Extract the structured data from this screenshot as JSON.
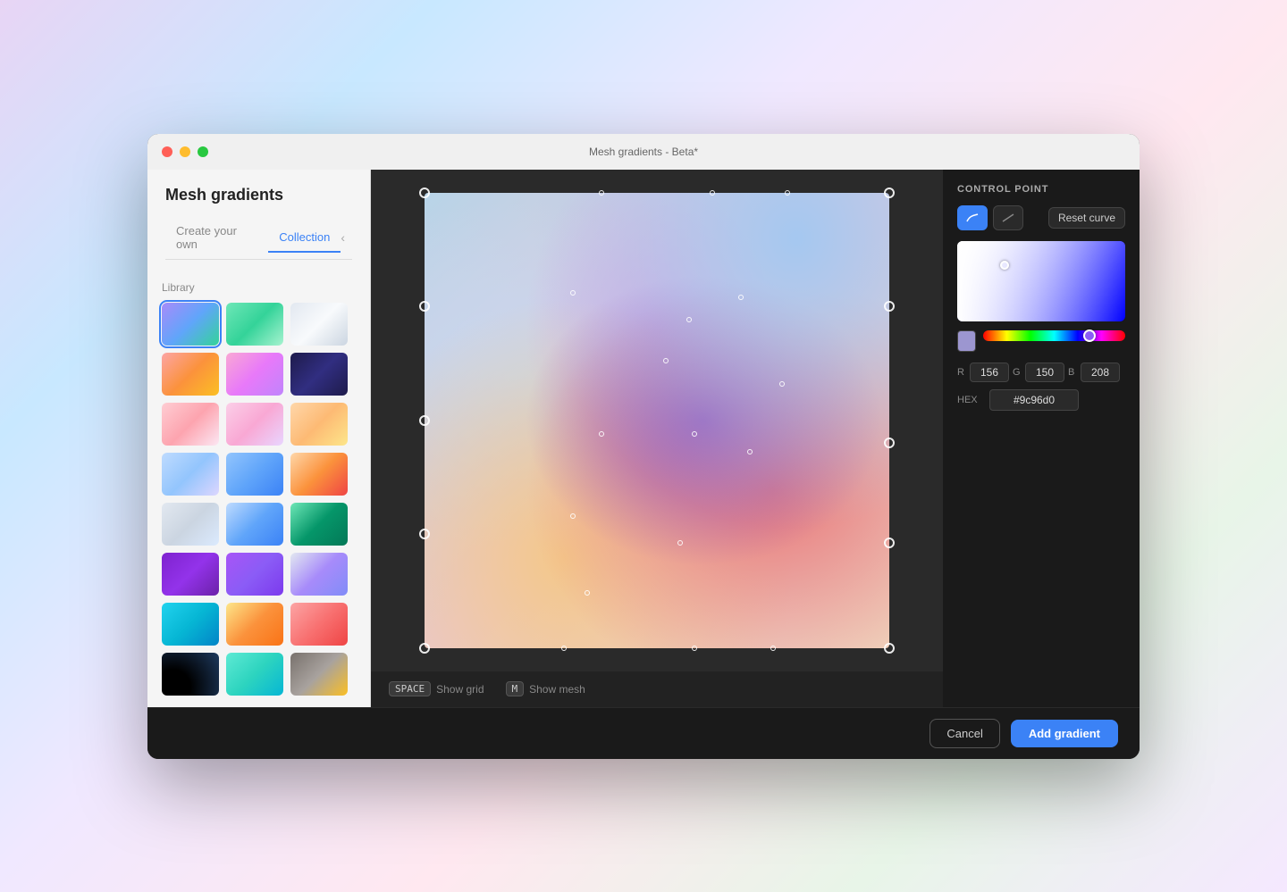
{
  "window": {
    "title": "Mesh gradients - Beta*"
  },
  "left_panel": {
    "title": "Mesh gradients",
    "tabs": [
      {
        "id": "create",
        "label": "Create your own",
        "active": false
      },
      {
        "id": "collection",
        "label": "Collection",
        "active": true
      }
    ],
    "tab_arrow": "‹",
    "library_label": "Library"
  },
  "right_panel": {
    "control_point_label": "CONTROL POINT",
    "reset_curve_label": "Reset curve",
    "rgb": {
      "r_label": "R",
      "r_value": "156",
      "g_label": "G",
      "g_value": "150",
      "b_label": "B",
      "b_value": "208"
    },
    "hex_label": "HEX",
    "hex_value": "#9c96d0"
  },
  "canvas": {
    "shortcut_space": "SPACE",
    "show_grid": "Show grid",
    "shortcut_m": "M",
    "show_mesh": "Show mesh"
  },
  "footer": {
    "cancel_label": "Cancel",
    "add_label": "Add gradient"
  }
}
